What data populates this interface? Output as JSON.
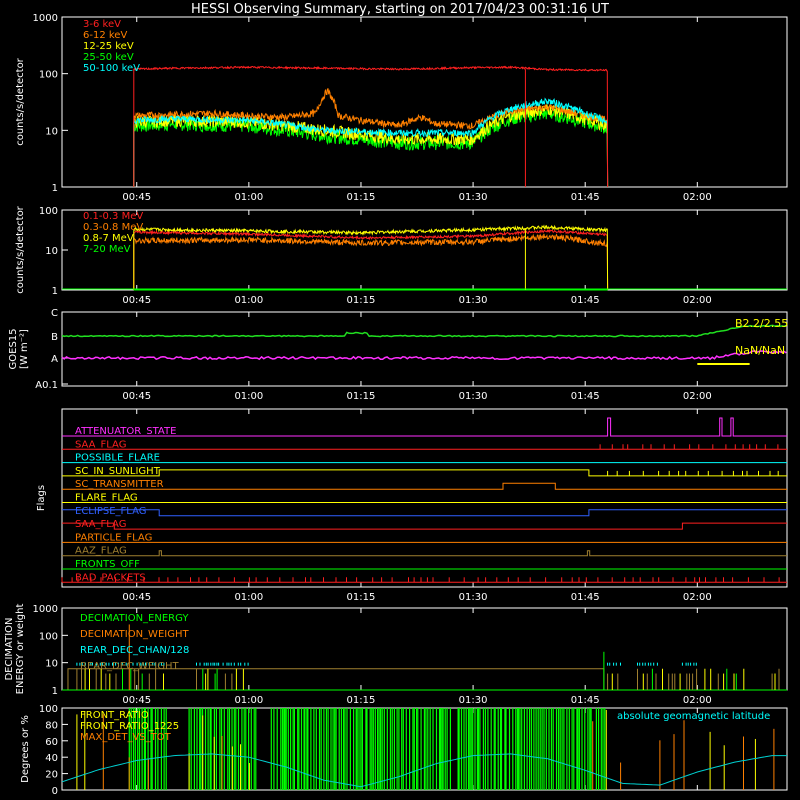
{
  "title": "HESSI Observing Summary, starting on 2017/04/23 00:31:16 UT",
  "time_axis": {
    "range_min": [
      35,
      132
    ],
    "ticks": [
      {
        "min": 45,
        "label": "00:45"
      },
      {
        "min": 60,
        "label": "01:00"
      },
      {
        "min": 75,
        "label": "01:15"
      },
      {
        "min": 90,
        "label": "01:30"
      },
      {
        "min": 105,
        "label": "01:45"
      },
      {
        "min": 120,
        "label": "02:00"
      }
    ]
  },
  "chart_data": [
    {
      "type": "line",
      "id": "counts",
      "ylabel": "counts/s/detector",
      "yscale": "log",
      "ylim": [
        1,
        1000
      ],
      "yticks": [
        "1",
        "10",
        "100",
        "1000"
      ],
      "legend": [
        {
          "name": "3-6 keV",
          "color": "#ff2020"
        },
        {
          "name": "6-12 keV",
          "color": "#ff8000"
        },
        {
          "name": "12-25 keV",
          "color": "#ffff00"
        },
        {
          "name": "25-50 keV",
          "color": "#00ff00"
        },
        {
          "name": "50-100 keV",
          "color": "#00ffff"
        }
      ],
      "series": [
        {
          "name": "3-6 keV",
          "color": "#ff2020",
          "x": [
            44.6,
            50,
            60,
            70,
            80,
            90,
            95,
            100,
            108
          ],
          "y": [
            120,
            125,
            130,
            125,
            120,
            128,
            130,
            118,
            115
          ]
        },
        {
          "name": "6-12 keV",
          "color": "#ff8000",
          "x": [
            44.6,
            50,
            55,
            60,
            65,
            69,
            70.5,
            72,
            75,
            80,
            83,
            85,
            90,
            95,
            100,
            105,
            108
          ],
          "y": [
            18,
            19,
            20,
            18,
            17,
            20,
            50,
            18,
            15,
            12,
            17,
            13,
            12,
            22,
            26,
            18,
            15
          ]
        },
        {
          "name": "12-25 keV",
          "color": "#ffff00",
          "x": [
            44.6,
            50,
            60,
            70,
            80,
            90,
            95,
            100,
            105,
            108
          ],
          "y": [
            14,
            15,
            14,
            10,
            7,
            7,
            18,
            24,
            16,
            12
          ]
        },
        {
          "name": "25-50 keV",
          "color": "#00ff00",
          "x": [
            44.6,
            50,
            60,
            70,
            80,
            90,
            95,
            100,
            105,
            108
          ],
          "y": [
            12,
            13,
            12,
            8,
            6,
            6,
            16,
            20,
            14,
            11
          ]
        },
        {
          "name": "50-100 keV",
          "color": "#00ffff",
          "x": [
            44.6,
            50,
            60,
            70,
            80,
            90,
            95,
            100,
            105,
            108
          ],
          "y": [
            15,
            16,
            15,
            10,
            9,
            9,
            24,
            33,
            20,
            14
          ]
        }
      ]
    },
    {
      "type": "line",
      "id": "mev",
      "ylabel": "counts/s/detector",
      "yscale": "log",
      "ylim": [
        1,
        100
      ],
      "yticks": [
        "1",
        "10",
        "100"
      ],
      "legend": [
        {
          "name": "0.1-0.3 MeV",
          "color": "#ff2020"
        },
        {
          "name": "0.3-0.8 MeV",
          "color": "#ff8000"
        },
        {
          "name": "0.8-7 MeV",
          "color": "#ffff00"
        },
        {
          "name": "7-20 MeV",
          "color": "#00ff00"
        }
      ],
      "series": [
        {
          "name": "0.1-0.3 MeV",
          "color": "#ff2020",
          "x": [
            44.6,
            60,
            75,
            90,
            100,
            108
          ],
          "y": [
            28,
            25,
            20,
            22,
            30,
            24
          ]
        },
        {
          "name": "0.3-0.8 MeV",
          "color": "#ff8000",
          "x": [
            44.6,
            60,
            75,
            90,
            100,
            108
          ],
          "y": [
            17,
            18,
            15,
            16,
            22,
            14
          ]
        },
        {
          "name": "0.8-7 MeV",
          "color": "#ffff00",
          "x": [
            44.6,
            60,
            75,
            90,
            100,
            108
          ],
          "y": [
            33,
            30,
            27,
            32,
            37,
            31
          ]
        },
        {
          "name": "7-20 MeV",
          "color": "#00ff00",
          "x": [
            44.6,
            108
          ],
          "y": [
            1,
            1
          ]
        }
      ]
    },
    {
      "type": "line",
      "id": "goes",
      "ylabel_lines": [
        "GOES15",
        "[W m⁻²]"
      ],
      "yticks": [
        "A0.1",
        "A",
        "B",
        "C"
      ],
      "series": [
        {
          "name": "GOES long",
          "color": "#20e020",
          "level": "B2.2"
        },
        {
          "name": "GOES short",
          "color": "#ff30ff",
          "level": "A4"
        }
      ],
      "annotations": [
        "B2.2/2.55",
        "NaN/NaN"
      ]
    },
    {
      "type": "line",
      "id": "flags",
      "ylabel": "Flags",
      "flags": [
        {
          "name": "ATTENUATOR_STATE",
          "color": "#ff30ff"
        },
        {
          "name": "SAA_FLAG",
          "color": "#ff2020"
        },
        {
          "name": "POSSIBLE_FLARE",
          "color": "#00ffff"
        },
        {
          "name": "SC_IN_SUNLIGHT",
          "color": "#ffff00"
        },
        {
          "name": "SC_TRANSMITTER",
          "color": "#ff8000"
        },
        {
          "name": "FLARE_FLAG",
          "color": "#ffff00"
        },
        {
          "name": "ECLIPSE_FLAG",
          "color": "#3060ff"
        },
        {
          "name": "SAA_FLAG",
          "color": "#ff2020"
        },
        {
          "name": "PARTICLE_FLAG",
          "color": "#ff8000"
        },
        {
          "name": "AAZ_FLAG",
          "color": "#a08030"
        },
        {
          "name": "FRONTS_OFF",
          "color": "#00ff00"
        },
        {
          "name": "BAD_PACKETS",
          "color": "#ff2020"
        }
      ]
    },
    {
      "type": "line",
      "id": "decimation",
      "ylabel_lines": [
        "DECIMATION",
        "ENERGY or weight"
      ],
      "yscale": "log",
      "ylim": [
        1,
        1000
      ],
      "yticks": [
        "1",
        "10",
        "100",
        "1000"
      ],
      "legend": [
        {
          "name": "DECIMATION_ENERGY",
          "color": "#00ff00"
        },
        {
          "name": "DECIMATION_WEIGHT",
          "color": "#ff8000"
        },
        {
          "name": "REAR_DEC_CHAN/128",
          "color": "#00ffff"
        },
        {
          "name": "REAR_DEC_WEIGHT",
          "color": "#a08030"
        }
      ]
    },
    {
      "type": "line",
      "id": "ratio",
      "ylabel": "Degrees or %",
      "ylim": [
        0,
        100
      ],
      "yticks": [
        "0",
        "20",
        "40",
        "60",
        "80",
        "100"
      ],
      "legend": [
        {
          "name": "FRONT_RATIO",
          "color": "#ffff00"
        },
        {
          "name": "FRONT_RATIO_1225",
          "color": "#ffff00"
        },
        {
          "name": "MAX_DET_VS_TOT",
          "color": "#ff8000"
        }
      ],
      "right_legend": "absolute geomagnetic latitude",
      "series": [
        {
          "name": "absolute geomagnetic latitude",
          "color": "#00d0d0",
          "x": [
            35,
            40,
            45,
            50,
            55,
            60,
            65,
            70,
            75,
            80,
            85,
            90,
            95,
            100,
            105,
            110,
            115,
            120,
            125,
            130
          ],
          "y": [
            10,
            25,
            36,
            42,
            44,
            40,
            28,
            12,
            4,
            16,
            32,
            42,
            44,
            38,
            24,
            8,
            6,
            22,
            34,
            42
          ]
        }
      ]
    }
  ]
}
